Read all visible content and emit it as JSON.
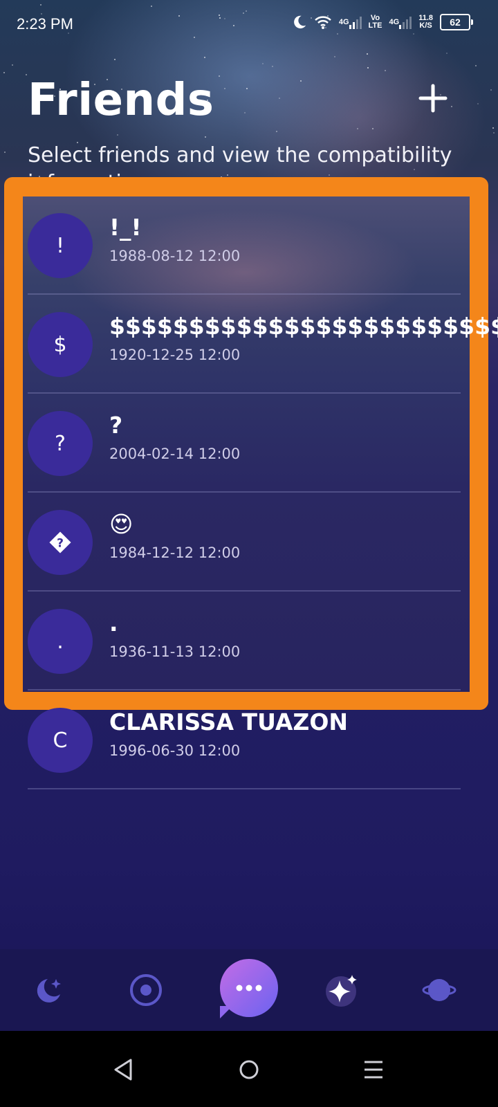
{
  "status_bar": {
    "time": "2:23 PM",
    "network_1": "4G",
    "volte_top": "Vo",
    "volte_bottom": "LTE",
    "network_2": "4G",
    "speed_value": "11.8",
    "speed_unit": "K/S",
    "battery": "62"
  },
  "header": {
    "title": "Friends",
    "subtitle": "Select friends and view the compatibility information"
  },
  "friends": [
    {
      "initial": "!",
      "name": "!_!",
      "date": "1988-08-12 12:00"
    },
    {
      "initial": "$",
      "name": "$$$$$$$$$$$$$$$$$$$$$$$$$$",
      "date": "1920-12-25 12:00"
    },
    {
      "initial": "?",
      "name": "?",
      "date": "2004-02-14 12:00"
    },
    {
      "initial": "�",
      "name": "😍",
      "date": "1984-12-12 12:00"
    },
    {
      "initial": ".",
      "name": ".",
      "date": "1936-11-13 12:00"
    },
    {
      "initial": "C",
      "name": "CLARISSA TUAZON",
      "date": "1996-06-30 12:00"
    }
  ],
  "icons": {
    "add": "plus-icon",
    "nav": [
      "moon-stars-icon",
      "target-icon",
      "chat-bubble-icon",
      "sparkle-icon",
      "planet-icon"
    ],
    "android": [
      "back-icon",
      "home-icon",
      "menu-icon"
    ]
  },
  "colors": {
    "highlight": "#f4861a",
    "avatar": "#3a2b9a",
    "active_nav": "#ffffff",
    "inactive_nav": "#5b57c8"
  }
}
